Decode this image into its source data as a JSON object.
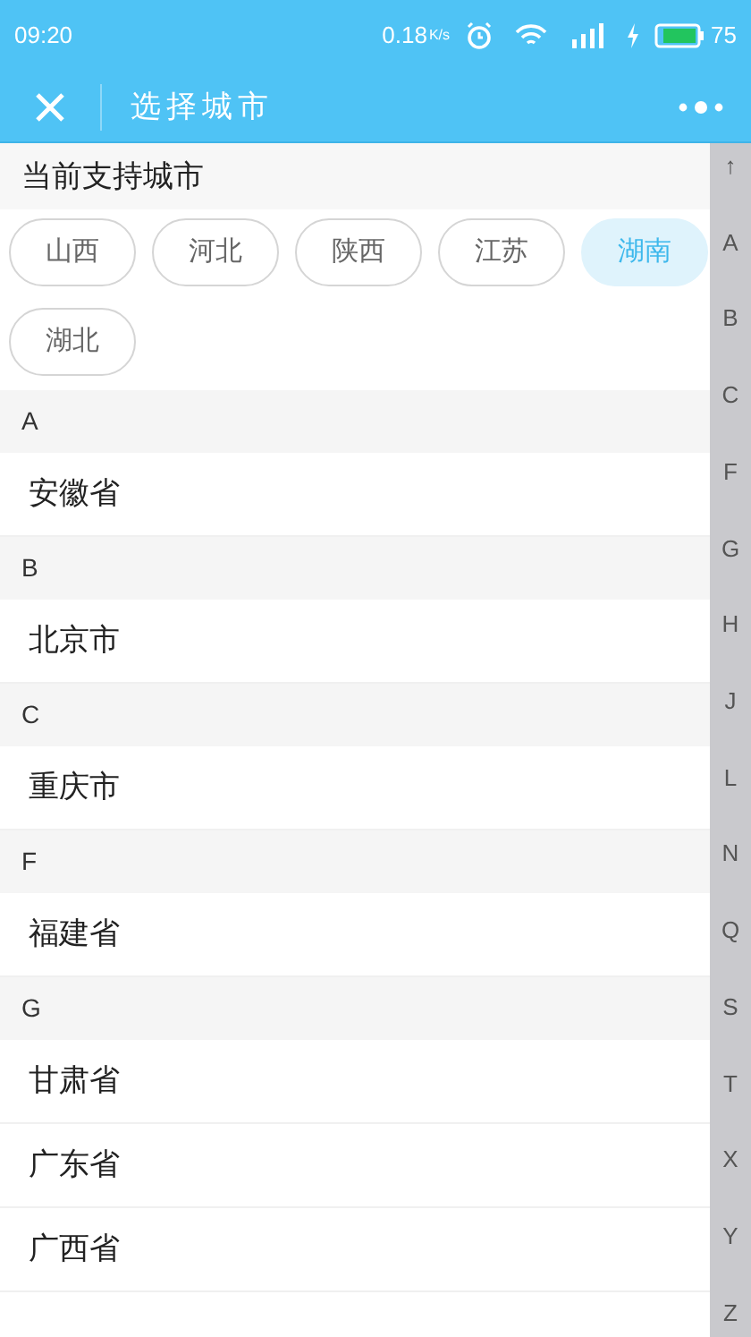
{
  "status_bar": {
    "time": "09:20",
    "speed": "0.18",
    "speed_unit": "K/s",
    "battery": "75"
  },
  "header": {
    "title": "选择城市"
  },
  "supported": {
    "title": "当前支持城市",
    "chips": [
      {
        "label": "山西",
        "selected": false
      },
      {
        "label": "河北",
        "selected": false
      },
      {
        "label": "陕西",
        "selected": false
      },
      {
        "label": "江苏",
        "selected": false
      },
      {
        "label": "湖南",
        "selected": true
      },
      {
        "label": "湖北",
        "selected": false
      }
    ]
  },
  "sections": [
    {
      "letter": "A",
      "items": [
        "安徽省"
      ]
    },
    {
      "letter": "B",
      "items": [
        "北京市"
      ]
    },
    {
      "letter": "C",
      "items": [
        "重庆市"
      ]
    },
    {
      "letter": "F",
      "items": [
        "福建省"
      ]
    },
    {
      "letter": "G",
      "items": [
        "甘肃省",
        "广东省",
        "广西省"
      ]
    }
  ],
  "index": [
    "↑",
    "A",
    "B",
    "C",
    "F",
    "G",
    "H",
    "J",
    "L",
    "N",
    "Q",
    "S",
    "T",
    "X",
    "Y",
    "Z"
  ]
}
